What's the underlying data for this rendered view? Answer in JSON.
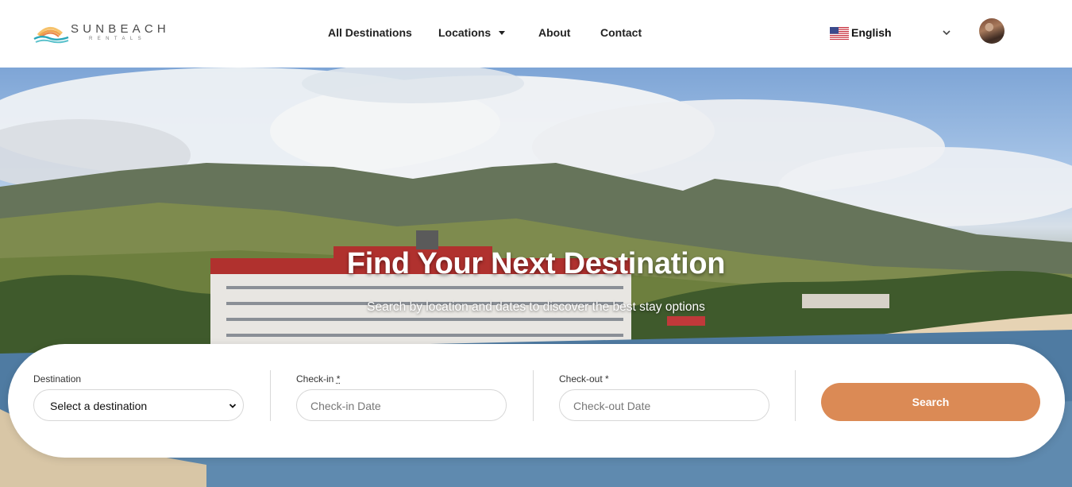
{
  "brand": {
    "name": "SUNBEACH",
    "tagline": "RENTALS"
  },
  "nav": {
    "all_destinations": "All Destinations",
    "locations": "Locations",
    "about": "About",
    "contact": "Contact"
  },
  "language": {
    "label": "English",
    "flag_icon": "us-flag-icon"
  },
  "hero": {
    "title": "Find Your Next Destination",
    "subtitle": "Search by location and dates to discover the best stay options"
  },
  "search": {
    "destination_label": "Destination",
    "destination_value": "Select a destination",
    "checkin_label": "Check-in",
    "checkin_placeholder": "Check-in Date",
    "checkout_label": "Check-out",
    "checkout_placeholder": "Check-out Date",
    "required_mark": "*",
    "button_label": "Search"
  },
  "colors": {
    "accent": "#db8a55",
    "text_dark": "#222222",
    "logo_teal": "#2aa7b8",
    "logo_orange": "#f0a24a"
  }
}
